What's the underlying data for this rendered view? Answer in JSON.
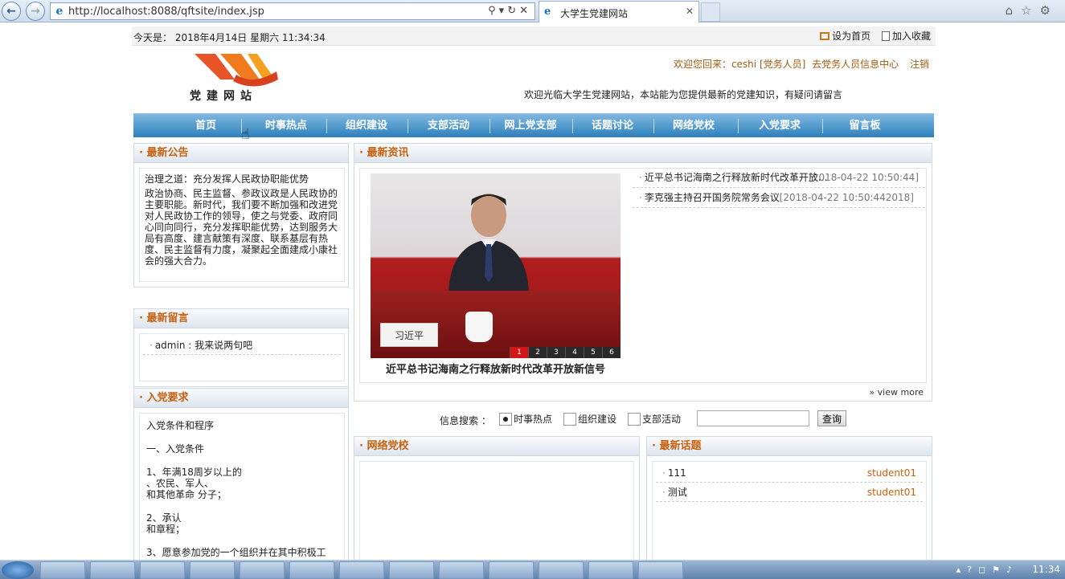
{
  "browser": {
    "url": "http://localhost:8088/qftsite/index.jsp",
    "tab_title": "大学生党建网站",
    "tab_close": "✕"
  },
  "site": {
    "date_label": "今天是：",
    "date_value": "2018年4月14日  星期六  11:34:34",
    "set_home": "设为首页",
    "add_favorite": "加入收藏",
    "logo_text": "党建网站",
    "welcome": "欢迎您回来：ceshi [党务人员]",
    "member_center": "去党务人员信息中心",
    "logout": "注销",
    "slogan": "欢迎光临大学生党建网站，本站能为您提供最新的党建知识，有疑问请留言"
  },
  "nav": [
    "首页",
    "时事热点",
    "组织建设",
    "支部活动",
    "网上党支部",
    "话题讨论",
    "网络党校",
    "入党要求",
    "留言板"
  ],
  "notice": {
    "title": "最新公告",
    "heading": "治理之道：充分发挥人民政协职能优势",
    "body": "政治协商、民主监督、参政议政是人民政协的主要职能。新时代，我们要不断加强和改进党对人民政协工作的领导，使之与党委、政府同心同向同行，充分发挥职能优势，达到服务大局有高度、建言献策有深度、联系基层有热度、民主监督有力度，凝聚起全面建成小康社会的强大合力。"
  },
  "messages": {
    "title": "最新留言",
    "items": [
      {
        "text": "admin : 我来说两句吧"
      }
    ]
  },
  "join": {
    "title": "入党要求",
    "lines": [
      "入党条件和程序",
      "一、入党条件",
      "1、年满18周岁以上的",
      "、农民、军人、",
      "和其他革命  分子；",
      "2、承认",
      "和章程；",
      "3、愿意参加党的一个组织并在其中积极工"
    ]
  },
  "news": {
    "title": "最新资讯",
    "photo_nameplate": "习近平",
    "caption": "近平总书记海南之行释放新时代改革开放新信号",
    "pager": [
      "1",
      "2",
      "3",
      "4",
      "5",
      "6"
    ],
    "items": [
      {
        "title": "近平总书记海南之行释放新时代改革开放...",
        "date": "[2018-04-22 10:50:44]"
      },
      {
        "title": "李克强主持召开国务院常务会议",
        "date": "[2018-04-22 10:50:442018]"
      }
    ],
    "view_more": "view more"
  },
  "search": {
    "label": "信息搜索 ：",
    "options": [
      "时事热点",
      "组织建设",
      "支部活动"
    ],
    "selected": "时事热点",
    "input_value": "",
    "button": "查询"
  },
  "school": {
    "title": "网络党校"
  },
  "topics": {
    "title": "最新话题",
    "items": [
      {
        "text": "111",
        "user": "student01"
      },
      {
        "text": "测试",
        "user": "student01"
      }
    ]
  },
  "taskbar": {
    "clock": "11:34"
  }
}
